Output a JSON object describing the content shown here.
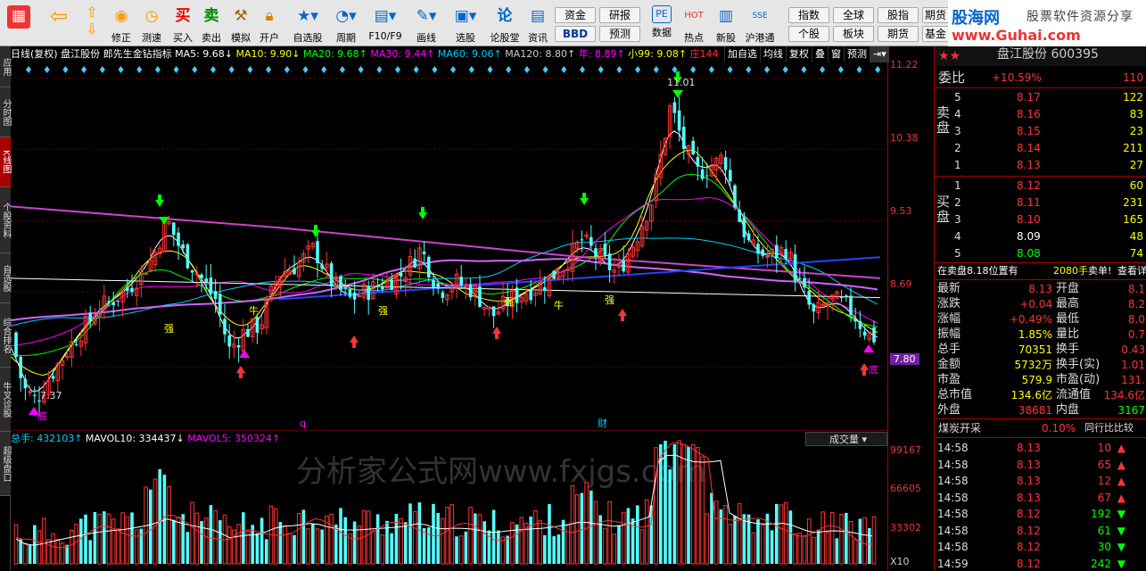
{
  "toolbar": {
    "buttons": [
      {
        "label": "",
        "icon": "home"
      },
      {
        "label": "",
        "icon": "back"
      },
      {
        "label": "",
        "icon": "arrows"
      },
      {
        "label": "修正",
        "icon": "fix"
      },
      {
        "label": "测速",
        "icon": "clock"
      },
      {
        "label": "买入",
        "icon": "buy"
      },
      {
        "label": "卖出",
        "icon": "sell"
      },
      {
        "label": "模拟",
        "icon": "hammer"
      },
      {
        "label": "开户",
        "icon": "lock"
      },
      {
        "label": "自选股",
        "icon": "star"
      },
      {
        "label": "周期",
        "icon": "cycle"
      },
      {
        "label": "F10/F9",
        "icon": "f10"
      },
      {
        "label": "画线",
        "icon": "pen"
      },
      {
        "label": "选股",
        "icon": "screen"
      },
      {
        "label": "论股堂",
        "icon": "forum"
      },
      {
        "label": "资讯",
        "icon": "news"
      },
      {
        "label": "数据",
        "icon": "pe"
      },
      {
        "label": "热点",
        "icon": "hot"
      },
      {
        "label": "新股",
        "icon": "new"
      },
      {
        "label": "沪港通",
        "icon": "sse"
      }
    ],
    "boxes": {
      "zijin": "资金",
      "yanbao": "研报",
      "bbd": "BBD",
      "yuce": "预测",
      "zhishu": "指数",
      "quanqiu": "全球",
      "guzhi": "股指",
      "qihuo": "期货",
      "gegu": "个股",
      "bankuai": "板块",
      "qihuo2": "期货",
      "jijin": "基金"
    },
    "logo": {
      "name": "股海网",
      "slogan": "股票软件资源分享",
      "url": "www.Guhai.com"
    }
  },
  "sidebar": [
    "应用",
    "分时图",
    "K线图",
    "个股资料",
    "自选股",
    "综合排名",
    "牛叉诊股",
    "超级盘口"
  ],
  "ktitle": {
    "mode": "日线(复权)",
    "stock": "盘江股份",
    "indicator": "郎先生金钻指标",
    "ma5": "MA5: 9.68↓",
    "ma10": "MA10: 9.90↓",
    "ma20": "MA20: 9.68↑",
    "ma30": "MA30: 9.44↑",
    "ma60": "MA60: 9.06↑",
    "ma120": "MA120: 8.80↑",
    "nian": "年: 8.89↑",
    "xiao": "小99: 9.08↑",
    "zhuang": "庄144",
    "btns": [
      "加自选",
      "均线",
      "复权",
      "叠",
      "窗",
      "预测"
    ]
  },
  "chart_annotations": {
    "high": "11.01",
    "low": "7.37",
    "di": "底",
    "qiang": "强",
    "niu": "牛",
    "q": "q",
    "cai": "财"
  },
  "yaxis": {
    "price": [
      "11.22",
      "10.38",
      "9.53",
      "8.69",
      "7.80"
    ],
    "vol": [
      "99167",
      "66605",
      "33302",
      "X10"
    ]
  },
  "vol_title": {
    "total": "总手: 432103↑",
    "mavol10": "MAVOL10: 334437↓",
    "mavol5": "MAVOL5: 350324↑",
    "sel": "成交量"
  },
  "watermark": "分析家公式网www.fxjgs.com",
  "panel": {
    "title": "盘江股份 600395",
    "weibi": {
      "label": "委比",
      "value": "+10.59%",
      "diff": "110"
    },
    "sell_label": "卖盘",
    "buy_label": "买盘",
    "sell": [
      {
        "n": "5",
        "p": "8.17",
        "v": "122"
      },
      {
        "n": "4",
        "p": "8.16",
        "v": "83"
      },
      {
        "n": "3",
        "p": "8.15",
        "v": "23"
      },
      {
        "n": "2",
        "p": "8.14",
        "v": "211"
      },
      {
        "n": "1",
        "p": "8.13",
        "v": "27"
      }
    ],
    "buy": [
      {
        "n": "1",
        "p": "8.12",
        "v": "60"
      },
      {
        "n": "2",
        "p": "8.11",
        "v": "231"
      },
      {
        "n": "3",
        "p": "8.10",
        "v": "165"
      },
      {
        "n": "4",
        "p": "8.09",
        "v": "48"
      },
      {
        "n": "5",
        "p": "8.08",
        "v": "74"
      }
    ],
    "pending": "在卖盘8.18位置有",
    "pending_vol": "2080手",
    "pending_act": "卖单!",
    "pending_link": "查看详细",
    "stats": [
      [
        "最新",
        "8.13",
        "开盘",
        "8.1"
      ],
      [
        "涨跌",
        "+0.04",
        "最高",
        "8.2"
      ],
      [
        "涨幅",
        "+0.49%",
        "最低",
        "8.0"
      ],
      [
        "振幅",
        "1.85%",
        "量比",
        "0.7"
      ],
      [
        "总手",
        "70351",
        "换手",
        "0.43"
      ],
      [
        "金额",
        "5732万",
        "换手(实)",
        "1.01"
      ],
      [
        "市盈",
        "579.9",
        "市盈(动)",
        "131."
      ],
      [
        "总市值",
        "134.6亿",
        "流通值",
        "134.6亿"
      ],
      [
        "外盘",
        "38681",
        "内盘",
        "3167"
      ]
    ],
    "sector": {
      "name": "煤炭开采",
      "pct": "0.10%",
      "cmp": "同行比比较"
    },
    "ticks": [
      {
        "t": "14:58",
        "p": "8.13",
        "v": "10",
        "d": "up"
      },
      {
        "t": "14:58",
        "p": "8.13",
        "v": "65",
        "d": "up"
      },
      {
        "t": "14:58",
        "p": "8.13",
        "v": "12",
        "d": "up"
      },
      {
        "t": "14:58",
        "p": "8.13",
        "v": "67",
        "d": "up"
      },
      {
        "t": "14:58",
        "p": "8.12",
        "v": "192",
        "d": "down"
      },
      {
        "t": "14:58",
        "p": "8.12",
        "v": "61",
        "d": "down"
      },
      {
        "t": "14:58",
        "p": "8.12",
        "v": "30",
        "d": "down"
      },
      {
        "t": "14:59",
        "p": "8.12",
        "v": "242",
        "d": "down"
      }
    ]
  },
  "colors": {
    "up": "#ff3333",
    "down": "#54ffff",
    "bg": "#000000",
    "grid": "#a00000"
  }
}
